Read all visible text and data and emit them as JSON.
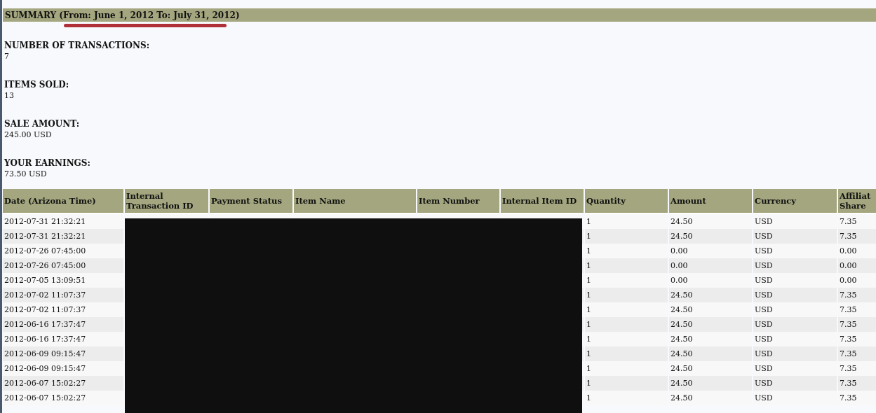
{
  "summary": {
    "title": "SUMMARY (From: June 1, 2012 To: July 31, 2012)",
    "stats": [
      {
        "label": "NUMBER OF TRANSACTIONS:",
        "value": "7"
      },
      {
        "label": "ITEMS SOLD:",
        "value": "13"
      },
      {
        "label": "SALE AMOUNT:",
        "value": "245.00 USD"
      },
      {
        "label": "YOUR EARNINGS:",
        "value": "73.50 USD"
      }
    ]
  },
  "table": {
    "columns": [
      "Date (Arizona Time)",
      "Internal Transaction ID",
      "Payment Status",
      "Item Name",
      "Item Number",
      "Internal Item ID",
      "Quantity",
      "Amount",
      "Currency",
      "Affiliat Share"
    ],
    "rows": [
      {
        "date": "2012-07-31 21:32:21",
        "quantity": "1",
        "amount": "24.50",
        "currency": "USD",
        "affiliate_share": "7.35"
      },
      {
        "date": "2012-07-31 21:32:21",
        "quantity": "1",
        "amount": "24.50",
        "currency": "USD",
        "affiliate_share": "7.35"
      },
      {
        "date": "2012-07-26 07:45:00",
        "quantity": "1",
        "amount": "0.00",
        "currency": "USD",
        "affiliate_share": "0.00"
      },
      {
        "date": "2012-07-26 07:45:00",
        "quantity": "1",
        "amount": "0.00",
        "currency": "USD",
        "affiliate_share": "0.00"
      },
      {
        "date": "2012-07-05 13:09:51",
        "quantity": "1",
        "amount": "0.00",
        "currency": "USD",
        "affiliate_share": "0.00"
      },
      {
        "date": "2012-07-02 11:07:37",
        "quantity": "1",
        "amount": "24.50",
        "currency": "USD",
        "affiliate_share": "7.35"
      },
      {
        "date": "2012-07-02 11:07:37",
        "quantity": "1",
        "amount": "24.50",
        "currency": "USD",
        "affiliate_share": "7.35"
      },
      {
        "date": "2012-06-16 17:37:47",
        "quantity": "1",
        "amount": "24.50",
        "currency": "USD",
        "affiliate_share": "7.35"
      },
      {
        "date": "2012-06-16 17:37:47",
        "quantity": "1",
        "amount": "24.50",
        "currency": "USD",
        "affiliate_share": "7.35"
      },
      {
        "date": "2012-06-09 09:15:47",
        "quantity": "1",
        "amount": "24.50",
        "currency": "USD",
        "affiliate_share": "7.35"
      },
      {
        "date": "2012-06-09 09:15:47",
        "quantity": "1",
        "amount": "24.50",
        "currency": "USD",
        "affiliate_share": "7.35"
      },
      {
        "date": "2012-06-07 15:02:27",
        "quantity": "1",
        "amount": "24.50",
        "currency": "USD",
        "affiliate_share": "7.35"
      },
      {
        "date": "2012-06-07 15:02:27",
        "quantity": "1",
        "amount": "24.50",
        "currency": "USD",
        "affiliate_share": "7.35"
      }
    ]
  }
}
